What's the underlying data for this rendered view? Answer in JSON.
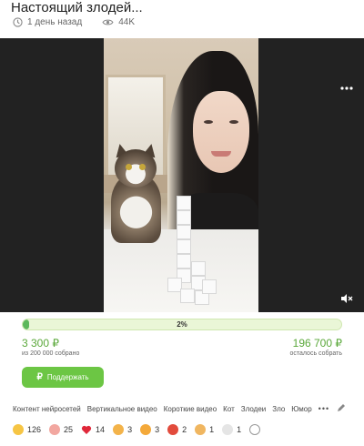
{
  "post": {
    "title": "Настоящий злодей...",
    "time": "1 день назад",
    "views": "44K"
  },
  "video": {
    "menu_icon": "more-dots-icon",
    "mute_icon": "speaker-muted-icon"
  },
  "fundraiser": {
    "progress_fraction": 0.02,
    "progress_label": "2%",
    "collected_amount": "3 300 ₽",
    "collected_sub": "из 200 000 собрано",
    "remaining_amount": "196 700 ₽",
    "remaining_sub": "осталось собрать",
    "support_button": "Поддержать",
    "support_icon": "ruble-icon",
    "accent_color": "#6cc644"
  },
  "tags": [
    "Контент нейросетей",
    "Вертикальное видео",
    "Короткие видео",
    "Кот",
    "Злодеи",
    "Зло",
    "Юмор"
  ],
  "tags_more": "•••",
  "reactions": [
    {
      "icon": "laughing-face-icon",
      "count": "126"
    },
    {
      "icon": "pig-face-icon",
      "count": "25"
    },
    {
      "icon": "heart-icon",
      "count": "14"
    },
    {
      "icon": "angry-face-icon",
      "count": "3"
    },
    {
      "icon": "fire-face-icon",
      "count": "3"
    },
    {
      "icon": "strawberry-icon",
      "count": "2"
    },
    {
      "icon": "clapping-hands-icon",
      "count": "1"
    },
    {
      "icon": "skull-icon",
      "count": "1"
    }
  ]
}
